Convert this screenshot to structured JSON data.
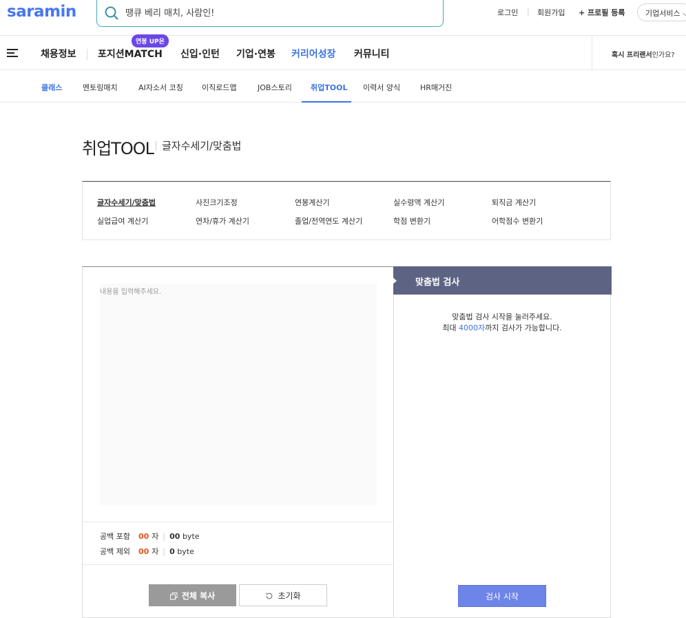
{
  "header": {
    "logo": "saramin",
    "search_placeholder": "땡큐 베리 매치, 사람인!",
    "login": "로그인",
    "separator": "|",
    "signup": "회원가입",
    "profile": "+ 프로필 등록",
    "business": "기업서비스 ⌵"
  },
  "nav": {
    "items": [
      "채용정보",
      "포지션MATCH",
      "신입·인턴",
      "기업·연봉",
      "커리어성장",
      "커뮤니티"
    ],
    "badge": "연봉 UP은",
    "freelancer_bold": "혹시 프리랜서",
    "freelancer_rest": "인가요?"
  },
  "subnav": {
    "items": [
      "클래스",
      "멘토링매치",
      "AI자소서 코칭",
      "이직로드맵",
      "JOB스토리",
      "취업TOOL",
      "이력서 양식",
      "HR매거진"
    ]
  },
  "page": {
    "title": "취업TOOL",
    "subtitle": "글자수세기/맞춤법"
  },
  "tools": {
    "items": [
      "글자수세기/맞춤법",
      "사진크기조정",
      "연봉계산기",
      "실수령액 계산기",
      "퇴직금 계산기",
      "실업급여 계산기",
      "연차/휴가 계산기",
      "졸업/전역연도 계산기",
      "학점 변환기",
      "어학점수 변환기"
    ]
  },
  "editor": {
    "placeholder": "내용을 입력해주세요.",
    "with_space_label": "공백 포함",
    "without_space_label": "공백 제외",
    "with_space_count": "00",
    "without_space_count": "00",
    "char_unit": "자",
    "with_space_bytes": "00",
    "without_space_bytes": "0",
    "byte_unit": "byte",
    "copy_button": "전체 복사",
    "reset_button": "초기화"
  },
  "spell": {
    "title": "맞춤법 검사",
    "msg1": "맞춤법 검사 시작을 눌러주세요.",
    "msg2_pre": "최대 ",
    "msg2_limit": "4000자",
    "msg2_post": "까지 검사가 가능합니다.",
    "check_button": "검사 시작"
  }
}
